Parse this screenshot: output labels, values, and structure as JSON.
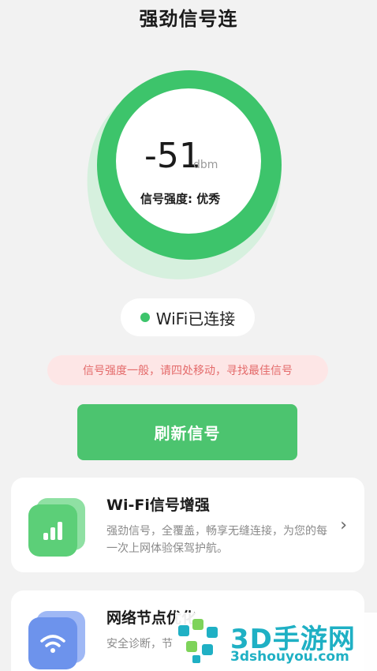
{
  "header": {
    "title": "强劲信号连"
  },
  "signal": {
    "value": "-51",
    "unit": "dbm",
    "strength_label": "信号强度: 优秀"
  },
  "wifi_status": {
    "text": "WiFi已连接",
    "dot_color": "#3dc46b"
  },
  "warning": {
    "text": "信号强度一般，请四处移动，寻找最佳信号"
  },
  "refresh_button": {
    "label": "刷新信号"
  },
  "cards": [
    {
      "title": "Wi-Fi信号增强",
      "description": "强劲信号，全覆盖，畅享无缝连接，为您的每一次上网体验保驾护航。",
      "icon": "signal-bars-icon",
      "color": "#5ccf78"
    },
    {
      "title": "网络节点优化",
      "description": "安全诊断，节",
      "icon": "wifi-shield-icon",
      "color": "#6d93ec"
    }
  ],
  "watermark": {
    "brand": "3D手游网",
    "url": "3dshouyou.com"
  },
  "colors": {
    "accent": "#3dc46b",
    "warning_text": "#e46b6b",
    "watermark": "#1fb0c4"
  }
}
